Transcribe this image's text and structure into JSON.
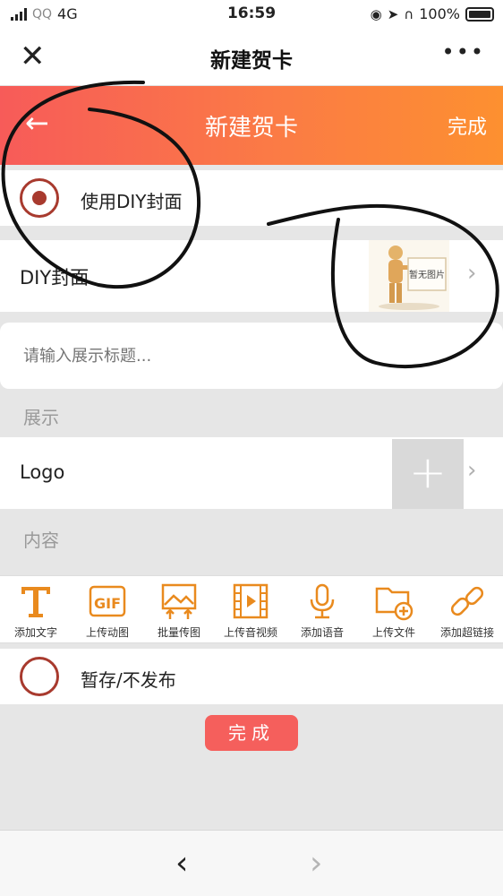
{
  "status_bar": {
    "apps": "QQ",
    "network": "4G",
    "time": "16:59",
    "battery": "100%"
  },
  "wechat_nav": {
    "close": "✕",
    "title": "新建贺卡",
    "more": "•••"
  },
  "header": {
    "back": "←",
    "title": "新建贺卡",
    "done": "完成",
    "gradient_colors": [
      "#f75b59",
      "#fd9030"
    ]
  },
  "diy_cover_toggle": {
    "label": "使用DIY封面",
    "selected": true
  },
  "diy_cover": {
    "label": "DIY封面",
    "image_text": "暂无图片"
  },
  "title_input": {
    "placeholder": "请输入展示标题...",
    "value": ""
  },
  "display_section": {
    "label": "展示"
  },
  "logo": {
    "label": "Logo",
    "add_icon": "+"
  },
  "content_section": {
    "label": "内容"
  },
  "toolbar": {
    "items": [
      {
        "icon": "text-icon",
        "label": "添加文字"
      },
      {
        "icon": "gif-icon",
        "label": "上传动图"
      },
      {
        "icon": "batch-image-icon",
        "label": "批量传图"
      },
      {
        "icon": "video-icon",
        "label": "上传音视频"
      },
      {
        "icon": "microphone-icon",
        "label": "添加语音"
      },
      {
        "icon": "folder-add-icon",
        "label": "上传文件"
      },
      {
        "icon": "link-icon",
        "label": "添加超链接"
      }
    ],
    "icon_color": "#e98a1e"
  },
  "draft_toggle": {
    "label": "暂存/不发布",
    "selected": false
  },
  "submit": {
    "label": "完成",
    "color": "#f55f5c"
  },
  "browser_nav": {
    "back": "‹",
    "forward": "›"
  }
}
